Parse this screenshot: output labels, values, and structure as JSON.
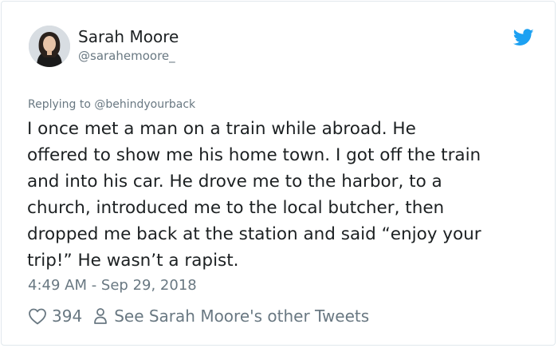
{
  "tweet": {
    "author": {
      "name": "Sarah Moore",
      "handle": "@sarahemoore_"
    },
    "brand_icon": "twitter-bird-icon",
    "brand_color": "#1da1f2",
    "replying_to": "Replying to @behindyourback",
    "text": "I once met a man on a train while abroad. He\noffered to show me his home town. I got off the train\nand into his car. He drove me to the harbor, to a\nchurch, introduced me to the local butcher, then\ndropped me back at the station and said “enjoy your\ntrip!” He wasn’t a rapist.",
    "timestamp": "4:49 AM - Sep 29, 2018",
    "likes": "394",
    "other_tweets_label": "See Sarah Moore's other Tweets"
  },
  "colors": {
    "text": "#1c2022",
    "secondary": "#697882",
    "border": "#e1e8ed"
  }
}
